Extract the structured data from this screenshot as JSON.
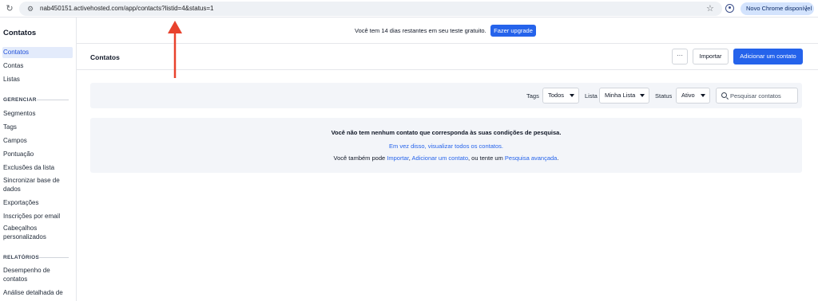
{
  "browser": {
    "url": "nab450151.activehosted.com/app/contacts?listid=4&status=1",
    "chrome_button": "Novo Chrome disponível",
    "chrome_button_more": "⋮"
  },
  "sidebar": {
    "title": "Contatos",
    "items_main": [
      {
        "label": "Contatos"
      },
      {
        "label": "Contas"
      },
      {
        "label": "Listas"
      }
    ],
    "section_manage": "GERENCIAR",
    "items_manage": [
      {
        "label": "Segmentos"
      },
      {
        "label": "Tags"
      },
      {
        "label": "Campos"
      },
      {
        "label": "Pontuação"
      },
      {
        "label": "Exclusões da lista"
      },
      {
        "label": "Sincronizar base de dados"
      },
      {
        "label": "Exportações"
      },
      {
        "label": "Inscrições por email"
      },
      {
        "label": "Cabeçalhos personalizados"
      }
    ],
    "section_reports": "RELATÓRIOS",
    "items_reports": [
      {
        "label": "Desempenho de contatos"
      },
      {
        "label": "Análise detalhada de"
      }
    ]
  },
  "trial": {
    "text": "Você tem 14 dias restantes em seu teste gratuito.",
    "upgrade": "Fazer upgrade"
  },
  "header": {
    "title": "Contatos",
    "more": "···",
    "import": "Importar",
    "add": "Adicionar um contato"
  },
  "filters": {
    "tags_label": "Tags",
    "tags_value": "Todos",
    "list_label": "Lista",
    "list_value": "Minha Lista",
    "status_label": "Status",
    "status_value": "Ativo",
    "search_placeholder": "Pesquisar contatos"
  },
  "empty": {
    "title": "Você não tem nenhum contato que corresponda às suas condições de pesquisa.",
    "view_all": "Em vez disso, visualizar todos os contatos.",
    "also_prefix": "Você também pode ",
    "link_import": "Importar",
    "sep1": ", ",
    "link_add": "Adicionar um contato",
    "mid": ", ou tente um ",
    "link_advanced": "Pesquisa avançada",
    "suffix": "."
  },
  "colors": {
    "accent": "#2563eb",
    "annotation_arrow": "#e8422d"
  }
}
